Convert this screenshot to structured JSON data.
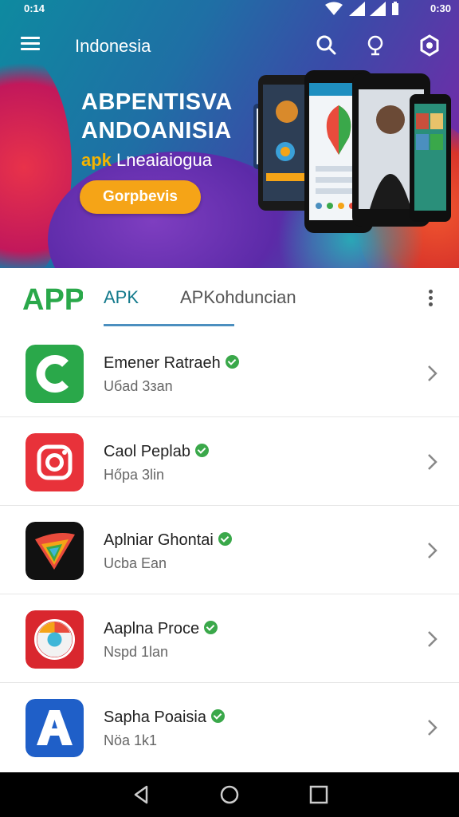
{
  "status_bar": {
    "time": "0:14",
    "time_right": "0:30"
  },
  "appbar": {
    "title": "Indonesia"
  },
  "hero": {
    "headline_1": "ABPENTISVA",
    "headline_2": "ANDOANISIA",
    "sub_apk": "apk",
    "sub_rest": "Lneaiaiogua",
    "cta_label": "Gorpbevis"
  },
  "tabs": {
    "logo": "APP",
    "active": "APK",
    "other": "APKohduncian"
  },
  "apps": [
    {
      "name": "Emener Ratraeh",
      "meta": "Uбad 3зan",
      "icon": "green-c-icon"
    },
    {
      "name": "Caol Peplab",
      "meta": "Hőpa 3lin",
      "icon": "camera-icon"
    },
    {
      "name": "Aplniar Ghontai",
      "meta": "Ucba Ean",
      "icon": "colorful-v-icon"
    },
    {
      "name": "Aaplna Proce",
      "meta": "Nspd 1lan",
      "icon": "red-chrome-icon"
    },
    {
      "name": "Sapha Poaisia",
      "meta": "Nöa 1k1",
      "icon": "blue-a-icon"
    }
  ],
  "colors": {
    "accent": "#137a8c",
    "cta": "#f5a417",
    "verified": "#3aa84a"
  }
}
